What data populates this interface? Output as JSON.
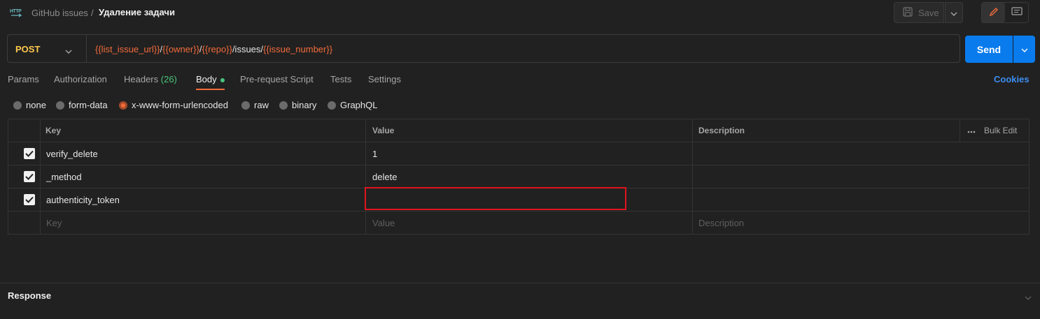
{
  "header": {
    "breadcrumb_parent": "GitHub issues",
    "breadcrumb_sep": "/",
    "title": "Удаление задачи",
    "save_label": "Save"
  },
  "request": {
    "method": "POST",
    "url_parts": [
      {
        "text": "{{list_issue_url}}",
        "var": true
      },
      {
        "text": "/",
        "var": false
      },
      {
        "text": "{{owner}}",
        "var": true
      },
      {
        "text": "/",
        "var": false
      },
      {
        "text": "{{repo}}",
        "var": true
      },
      {
        "text": "/issues/",
        "var": false
      },
      {
        "text": "{{issue_number}}",
        "var": true
      }
    ],
    "send_label": "Send"
  },
  "tabs": [
    {
      "label": "Params"
    },
    {
      "label": "Authorization"
    },
    {
      "label": "Headers",
      "count": "(26)"
    },
    {
      "label": "Body",
      "active": true
    },
    {
      "label": "Pre-request Script"
    },
    {
      "label": "Tests"
    },
    {
      "label": "Settings"
    }
  ],
  "cookies_label": "Cookies",
  "body_types": [
    {
      "label": "none"
    },
    {
      "label": "form-data"
    },
    {
      "label": "x-www-form-urlencoded",
      "selected": true
    },
    {
      "label": "raw"
    },
    {
      "label": "binary"
    },
    {
      "label": "GraphQL"
    }
  ],
  "table": {
    "headers": {
      "key": "Key",
      "value": "Value",
      "description": "Description",
      "bulk_edit": "Bulk Edit"
    },
    "rows": [
      {
        "key": "verify_delete",
        "value": "1",
        "description": "",
        "checked": true
      },
      {
        "key": "_method",
        "value": "delete",
        "description": "",
        "checked": true
      },
      {
        "key": "authenticity_token",
        "value": "",
        "description": "",
        "checked": true
      }
    ],
    "placeholders": {
      "key": "Key",
      "value": "Value",
      "description": "Description"
    }
  },
  "response_label": "Response",
  "colors": {
    "accent": "#f26b3a",
    "send": "#097bed",
    "method": "#ffc94d",
    "highlight": "#e0141e"
  }
}
